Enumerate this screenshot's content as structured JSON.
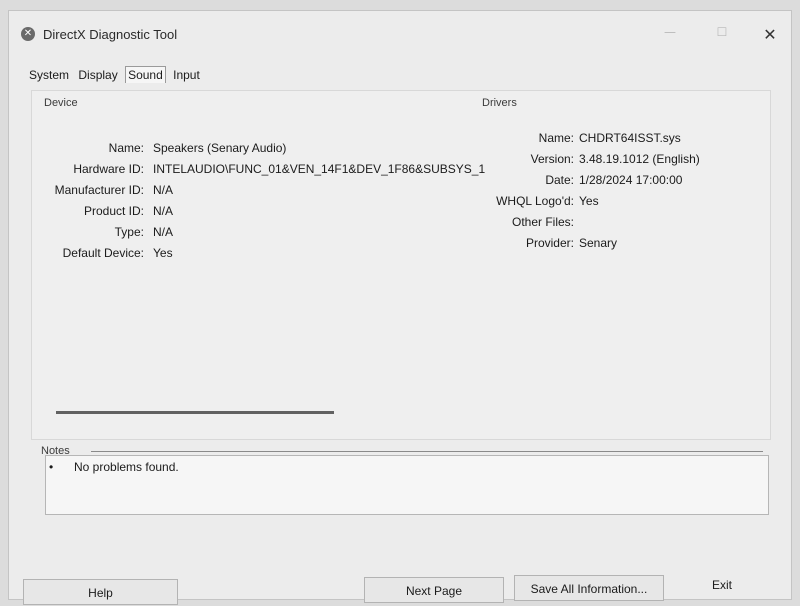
{
  "window": {
    "title": "DirectX Diagnostic Tool",
    "icon": "directx-x-icon",
    "controls": {
      "minimize": "—",
      "maximize": "☐",
      "close": "✕"
    }
  },
  "tabs": [
    {
      "label": "System",
      "active": false
    },
    {
      "label": "Display",
      "active": false
    },
    {
      "label": "Sound",
      "active": true
    },
    {
      "label": "Input",
      "active": false
    }
  ],
  "device": {
    "group_label": "Device",
    "fields": [
      {
        "label": "Name:",
        "value": "Speakers (Senary Audio)"
      },
      {
        "label": "Hardware ID:",
        "value": "INTELAUDIO\\FUNC_01&VEN_14F1&DEV_1F86&SUBSYS_1"
      },
      {
        "label": "Manufacturer ID:",
        "value": "N/A"
      },
      {
        "label": "Product ID:",
        "value": "N/A"
      },
      {
        "label": "Type:",
        "value": "N/A"
      },
      {
        "label": "Default Device:",
        "value": "Yes"
      }
    ]
  },
  "drivers": {
    "group_label": "Drivers",
    "fields": [
      {
        "label": "Name:",
        "value": "CHDRT64ISST.sys"
      },
      {
        "label": "Version:",
        "value": "3.48.19.1012 (English)"
      },
      {
        "label": "Date:",
        "value": "1/28/2024 17:00:00"
      },
      {
        "label": "WHQL Logo'd:",
        "value": "Yes"
      },
      {
        "label": "Other Files:",
        "value": ""
      },
      {
        "label": "Provider:",
        "value": "Senary"
      }
    ]
  },
  "notes": {
    "label": "Notes",
    "bullet": "•",
    "items": [
      "No problems found."
    ]
  },
  "buttons": {
    "help": "Help",
    "next_page": "Next Page",
    "save_all": "Save All Information...",
    "exit": "Exit"
  }
}
